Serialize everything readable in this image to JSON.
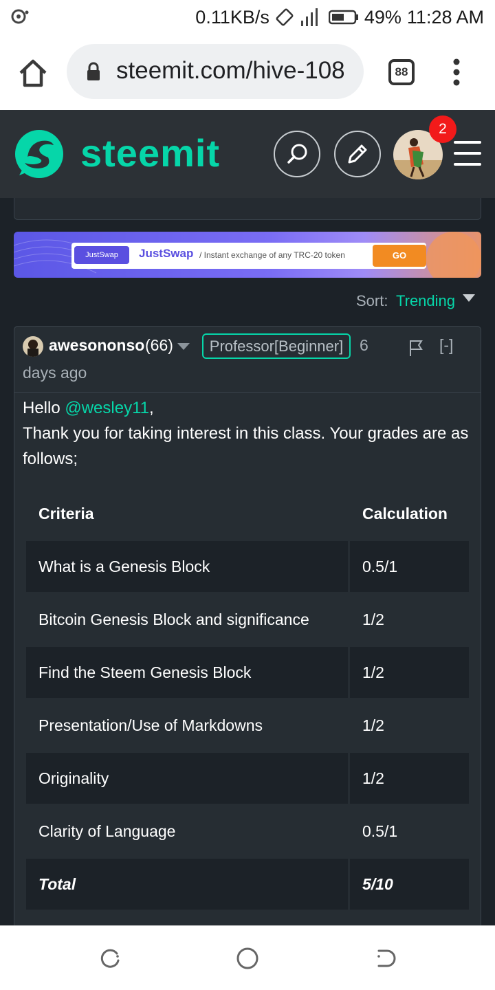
{
  "status_bar": {
    "network_speed": "0.11KB/s",
    "battery": "49%",
    "time": "11:28 AM",
    "icons": [
      "notification-icon",
      "rotate-lock-icon",
      "signal-icon",
      "battery-icon"
    ]
  },
  "browser": {
    "url": "steemit.com/hive-108",
    "tab_count": "88",
    "icons": [
      "home-icon",
      "lock-icon",
      "more-vert-icon"
    ]
  },
  "header": {
    "logo_text": "steemit",
    "notification_count": "2",
    "brand_color": "#06d6a9",
    "icons": [
      "search-icon",
      "pencil-icon",
      "menu-icon"
    ]
  },
  "banner": {
    "pill_label": "JustSwap",
    "title": "JustSwap",
    "subtitle": "/ Instant exchange of any TRC-20 token",
    "go_label": "GO"
  },
  "sort": {
    "label": "Sort:",
    "value": "Trending"
  },
  "comment": {
    "author": "awesononso",
    "reputation": "(66)",
    "badge": "Professor[Beginner]",
    "age_number": "6",
    "age_unit": "days ago",
    "collapse_label": "[-]",
    "greeting": "Hello ",
    "mention": "@wesley11",
    "greeting_end": ",",
    "message": "Thank you for taking interest in this class. Your grades are as follows;",
    "table": {
      "headers": [
        "Criteria",
        "Calculation"
      ],
      "rows": [
        [
          "What is a Genesis Block",
          "0.5/1"
        ],
        [
          "Bitcoin Genesis Block and significance",
          "1/2"
        ],
        [
          "Find the Steem Genesis Block",
          "1/2"
        ],
        [
          "Presentation/Use of Markdowns",
          "1/2"
        ],
        [
          "Originality",
          "1/2"
        ],
        [
          "Clarity of Language",
          "0.5/1"
        ]
      ],
      "total": [
        "Total",
        "5/10"
      ]
    }
  },
  "nav_bar": {
    "icons": [
      "recents-icon",
      "home-circle-icon",
      "back-icon"
    ]
  }
}
